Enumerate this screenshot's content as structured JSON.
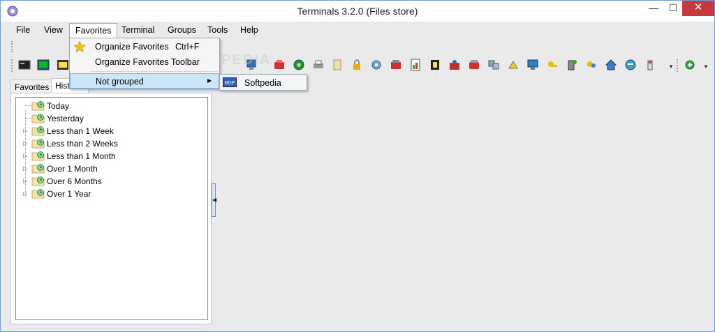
{
  "window": {
    "title": "Terminals 3.2.0 (Files store)",
    "controls": {
      "minimize": "—",
      "maximize": "☐",
      "close": "✕"
    }
  },
  "menubar": {
    "items": [
      "File",
      "View",
      "Favorites",
      "Terminal",
      "Groups",
      "Tools",
      "Help"
    ]
  },
  "favorites_menu": {
    "organize_favorites": "Organize Favorites",
    "organize_shortcut": "Ctrl+F",
    "organize_toolbar": "Organize Favorites Toolbar",
    "not_grouped": "Not grouped",
    "submenu": {
      "icon_text": "RDP",
      "item": "Softpedia"
    }
  },
  "tabs": {
    "favorites": "Favorites",
    "history": "Histo"
  },
  "history_tree": [
    {
      "label": "Today",
      "expandable": false
    },
    {
      "label": "Yesterday",
      "expandable": false
    },
    {
      "label": "Less than 1 Week",
      "expandable": true
    },
    {
      "label": "Less than 2 Weeks",
      "expandable": true
    },
    {
      "label": "Less than 1 Month",
      "expandable": true
    },
    {
      "label": "Over 1 Month",
      "expandable": true
    },
    {
      "label": "Over 6 Months",
      "expandable": true
    },
    {
      "label": "Over 1 Year",
      "expandable": true
    }
  ],
  "watermark": "SOFTPEDIA",
  "colors": {
    "accent": "#6e9ed8",
    "close": "#c7393b",
    "highlight": "#cde6f7"
  }
}
